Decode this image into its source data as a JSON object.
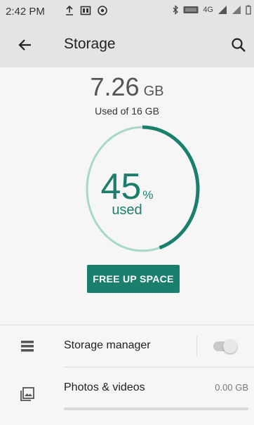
{
  "status_bar": {
    "time": "2:42 PM",
    "left_icons": [
      "upload-icon",
      "calendar-icon",
      "target-icon"
    ],
    "right_icons": [
      "bluetooth-icon",
      "volte-icon",
      "signal-4g-icon",
      "signal-icon",
      "battery-icon"
    ],
    "network": "4G"
  },
  "toolbar": {
    "title": "Storage",
    "back_icon": "arrow-back-icon",
    "search_icon": "search-icon"
  },
  "summary": {
    "used_value": "7.26",
    "used_unit": "GB",
    "used_of": "Used of 16 GB",
    "percent_value": "45",
    "percent_sign": "%",
    "percent_caption": "used",
    "percent_fraction": 0.45,
    "ring_track_color": "#a8d7cc",
    "ring_fill_color": "#1b7f6d"
  },
  "actions": {
    "free_up_label": "FREE UP SPACE"
  },
  "items": [
    {
      "label": "Storage manager",
      "icon": "storage-manager-icon",
      "toggle_on": false
    },
    {
      "label": "Photos & videos",
      "icon": "photos-icon",
      "size": "0.00 GB",
      "usage_fraction": 0.0
    }
  ],
  "colors": {
    "accent": "#1b7f6d",
    "toolbar_bg": "#e4e4e4",
    "page_bg": "#f6f6f6"
  }
}
